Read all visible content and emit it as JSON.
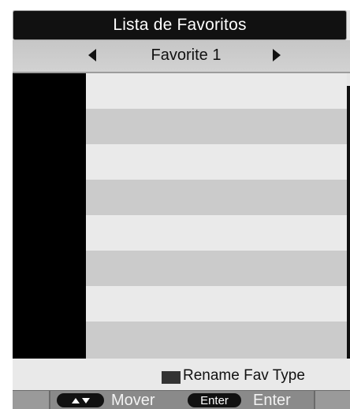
{
  "title": "Lista de Favoritos",
  "selector": {
    "label": "Favorite 1",
    "left_arrow_icon": "left-triangle-icon",
    "right_arrow_icon": "right-triangle-icon"
  },
  "list": {
    "rows": [
      "",
      "",
      "",
      "",
      "",
      "",
      "",
      ""
    ]
  },
  "legend": {
    "color": "#333333",
    "label": "Rename Fav Type"
  },
  "footer": {
    "updown_icon": "up-down-arrows-icon",
    "mover_label": "Mover",
    "enter_key_label": "Enter",
    "enter_label": "Enter"
  }
}
